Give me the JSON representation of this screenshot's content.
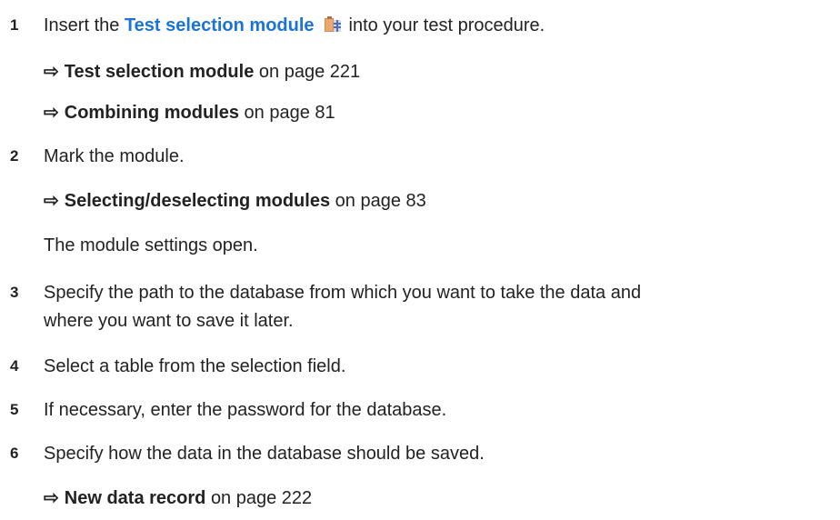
{
  "steps": [
    {
      "number": "1",
      "before": "Insert the",
      "link": "Test selection module",
      "after": "into your test procedure.",
      "icon": "module-icon",
      "refs": [
        {
          "title": "Test selection module",
          "suffix": "on page 221"
        },
        {
          "title": "Combining modules",
          "suffix": "on page 81"
        }
      ]
    },
    {
      "number": "2",
      "text": "Mark the module.",
      "refs": [
        {
          "title": "Selecting/deselecting modules",
          "suffix": "on page 83"
        }
      ],
      "note": "The module settings open."
    },
    {
      "number": "3",
      "text_line1": "Specify the path to the database from which you want to take the data and",
      "text_line2": "where you want to save it later."
    },
    {
      "number": "4",
      "text": "Select a table from the selection field."
    },
    {
      "number": "5",
      "text": "If necessary, enter the password for the database."
    },
    {
      "number": "6",
      "text": "Specify how the data in the database should be saved.",
      "refs": [
        {
          "title": "New data record",
          "suffix": "on page 222"
        }
      ]
    }
  ],
  "arrow_symbol": "⇨"
}
